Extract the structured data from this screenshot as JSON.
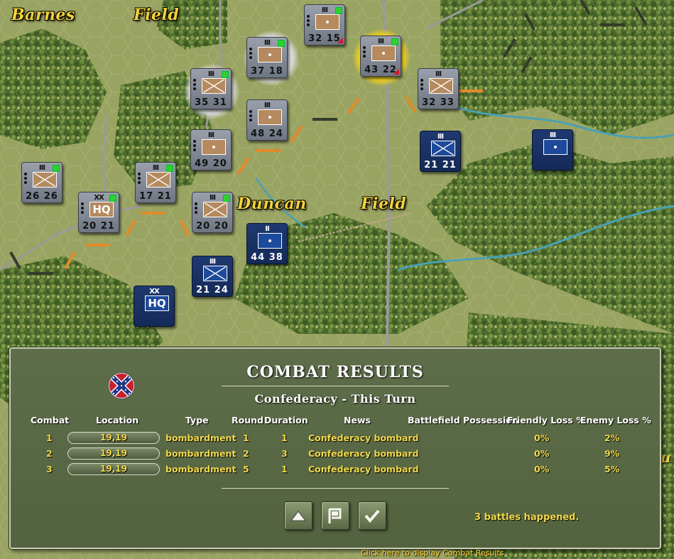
{
  "map": {
    "labels": [
      "Barnes",
      "Field",
      "Duncan",
      "Field"
    ],
    "edge_letter": "u",
    "units": [
      {
        "side": "csa",
        "size": "III",
        "values": "32 15",
        "flag": true,
        "red": true
      },
      {
        "side": "csa",
        "size": "III",
        "values": "37 18",
        "flag": true
      },
      {
        "side": "csa",
        "size": "III",
        "values": "43 22",
        "flag": true,
        "red": true
      },
      {
        "side": "csa",
        "size": "III",
        "values": "35 31",
        "flag": true
      },
      {
        "side": "csa",
        "size": "III",
        "values": "48 24"
      },
      {
        "side": "csa",
        "size": "III",
        "values": "32 33"
      },
      {
        "side": "csa",
        "size": "III",
        "values": "49 20"
      },
      {
        "side": "usa",
        "size": "III",
        "values": "21 21"
      },
      {
        "side": "usa",
        "size": "III",
        "values": ""
      },
      {
        "side": "csa",
        "size": "III",
        "values": "26 26",
        "flag": true
      },
      {
        "side": "csa",
        "size": "XX",
        "hq": "HQ",
        "values": "20 21",
        "flag": true
      },
      {
        "side": "csa",
        "size": "III",
        "values": "17 21",
        "flag": true
      },
      {
        "side": "csa",
        "size": "III",
        "values": "20 20",
        "flag": true
      },
      {
        "side": "usa",
        "size": "II",
        "values": "44 38"
      },
      {
        "side": "usa",
        "size": "III",
        "values": "21 24"
      },
      {
        "side": "usa",
        "size": "XX",
        "hq": "HQ",
        "values": ""
      }
    ]
  },
  "dialog": {
    "title": "COMBAT RESULTS",
    "subtitle": "Confederacy - This Turn",
    "flag_icon": "confederate-flag-icon",
    "headers": {
      "combat": "Combat",
      "location": "Location",
      "type": "Type",
      "round": "Round",
      "duration": "Duration",
      "news": "News",
      "possession": "Battlefield Possession",
      "friendly": "Friendly Loss %",
      "enemy": "Enemy Loss %"
    },
    "rows": [
      {
        "combat": "1",
        "location": "19,19",
        "type": "bombardment",
        "round": "1",
        "duration": "1",
        "news": "Confederacy bombard",
        "possession": "",
        "friendly": "0%",
        "enemy": "2%"
      },
      {
        "combat": "2",
        "location": "19,19",
        "type": "bombardment",
        "round": "2",
        "duration": "3",
        "news": "Confederacy bombard",
        "possession": "",
        "friendly": "0%",
        "enemy": "9%"
      },
      {
        "combat": "3",
        "location": "19,19",
        "type": "bombardment",
        "round": "5",
        "duration": "1",
        "news": "Confederacy bombard",
        "possession": "",
        "friendly": "0%",
        "enemy": "5%"
      }
    ],
    "buttons": [
      "up-arrow-icon",
      "flag-icon",
      "checkmark-icon"
    ],
    "summary": "3 battles happened."
  },
  "status": {
    "hint": "Click here to display Combat Results"
  }
}
